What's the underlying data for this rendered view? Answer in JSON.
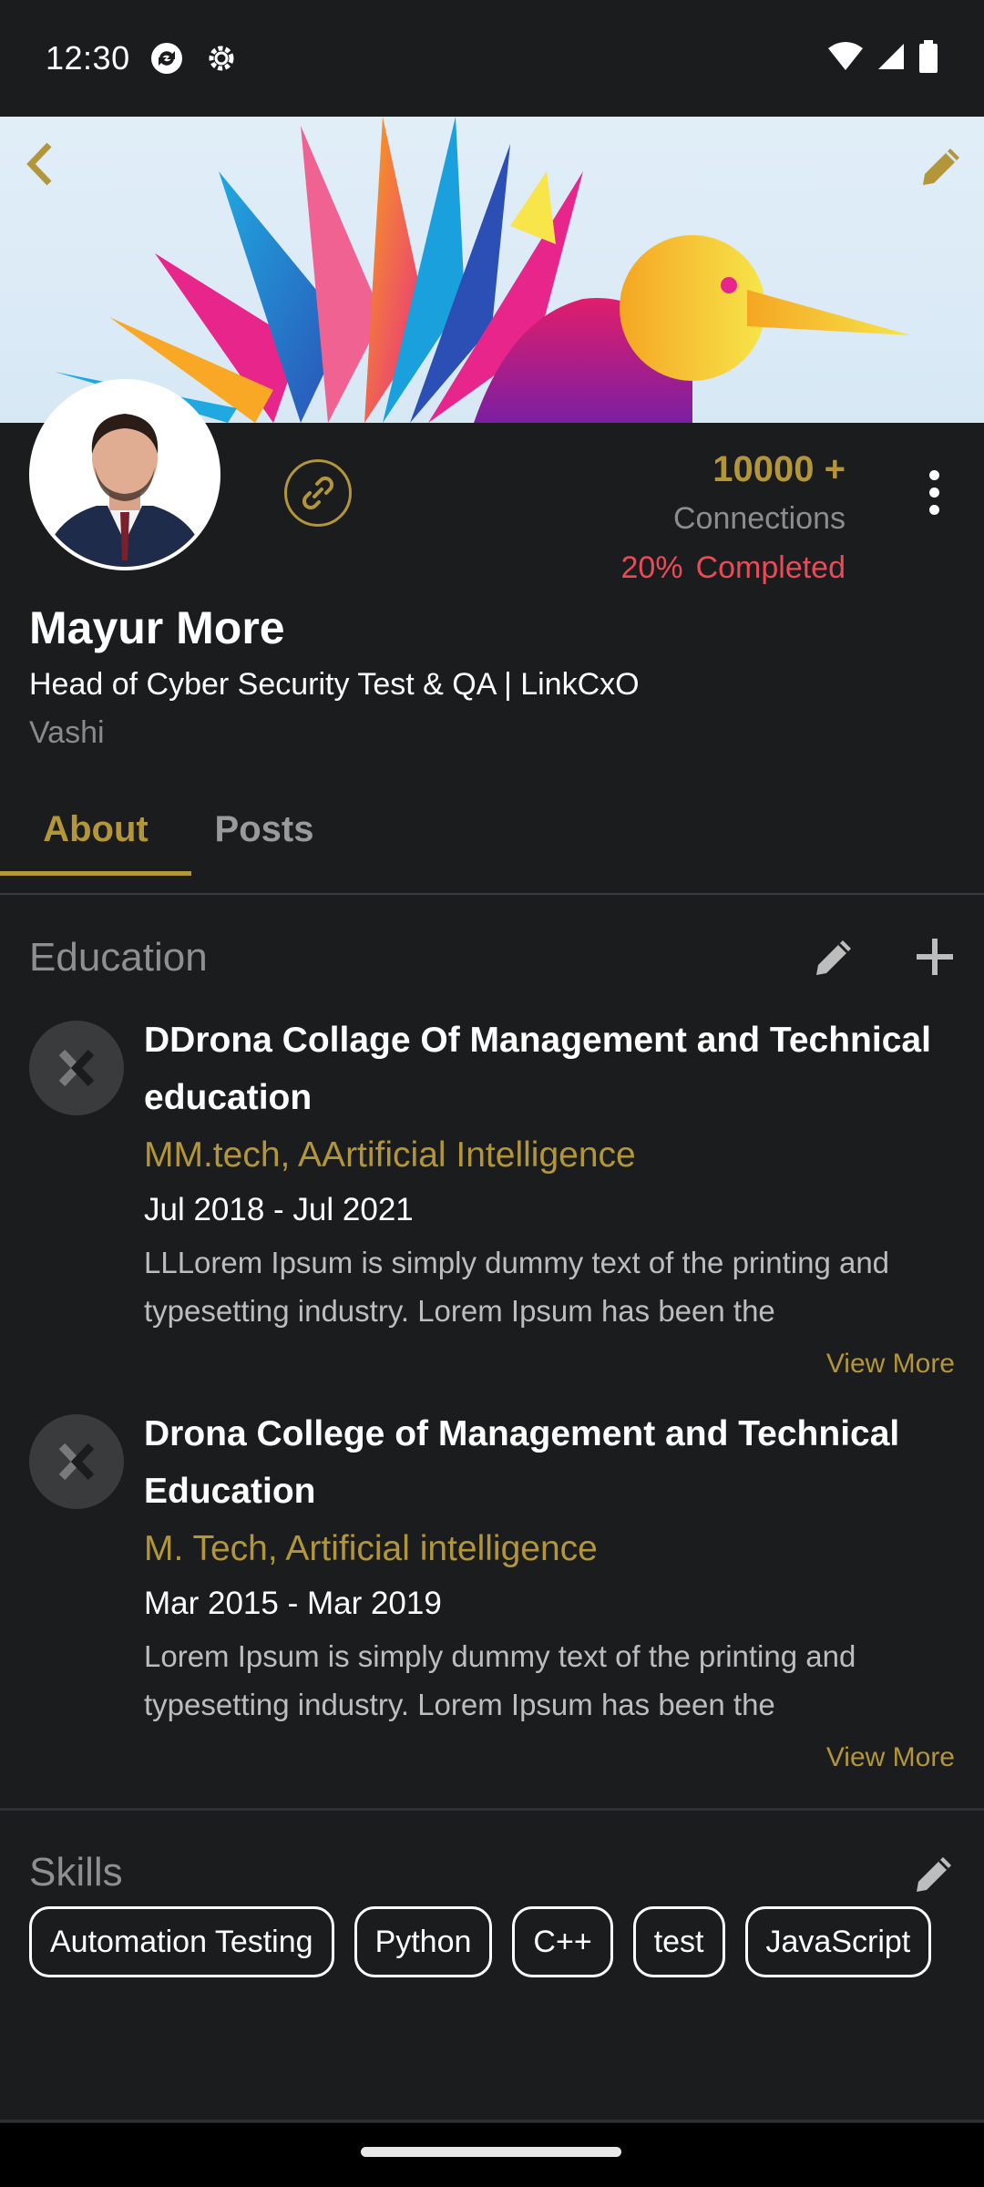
{
  "status_bar": {
    "time": "12:30"
  },
  "profile": {
    "connections_count": "10000 +",
    "connections_label": "Connections",
    "completion_percent": "20%",
    "completion_label": "Completed",
    "name": "Mayur More",
    "headline": "Head of Cyber Security Test & QA | LinkCxO",
    "location": "Vashi"
  },
  "tabs": [
    {
      "label": "About",
      "selected": true
    },
    {
      "label": "Posts",
      "selected": false
    }
  ],
  "education": {
    "title": "Education",
    "items": [
      {
        "school": "DDrona Collage Of Management and Technical education",
        "degree": "MM.tech, AArtificial Intelligence",
        "dates": "Jul 2018 - Jul 2021",
        "description": "LLLorem Ipsum is simply dummy text of the printing and typesetting industry. Lorem Ipsum has been the",
        "view_more": "View More"
      },
      {
        "school": "Drona College of Management and Technical Education",
        "degree": "M. Tech, Artificial intelligence",
        "dates": "Mar 2015 - Mar 2019",
        "description": "Lorem Ipsum is simply dummy text of the printing and typesetting industry. Lorem Ipsum has been the",
        "view_more": "View More"
      }
    ]
  },
  "skills": {
    "title": "Skills",
    "items": [
      "Automation Testing",
      "Python",
      "C++",
      "test",
      "JavaScript"
    ]
  },
  "colors": {
    "background": "#1b1c1e",
    "accent_gold": "#b39639",
    "completion_red": "#e94b57",
    "muted_text": "#8f8f8f"
  },
  "icons": {
    "back": "chevron-left-icon",
    "edit_cover": "pencil-icon",
    "link": "link-icon",
    "more": "more-vertical-icon",
    "edit": "pencil-icon",
    "add": "plus-icon",
    "school_logo": "placeholder-logo-icon"
  }
}
